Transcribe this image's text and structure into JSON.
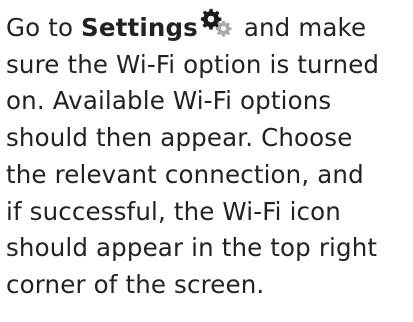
{
  "instruction": {
    "line1_prefix": "Go to ",
    "line1_settings": "Settings",
    "line1_suffix": " and make",
    "line2": "sure the Wi-Fi option is turned",
    "line3": "on. Available Wi-Fi options",
    "line4": "should then appear. Choose",
    "line5": "the relevant connection, and",
    "line6": "if successful, the Wi-Fi icon",
    "line7": "should appear in the top right",
    "line8": "corner of the screen."
  },
  "icons": {
    "settings_icon": "gear-icon"
  },
  "colors": {
    "text": "#222222",
    "gear_dark": "#1a1a1a",
    "gear_light": "#a9a9a9"
  }
}
